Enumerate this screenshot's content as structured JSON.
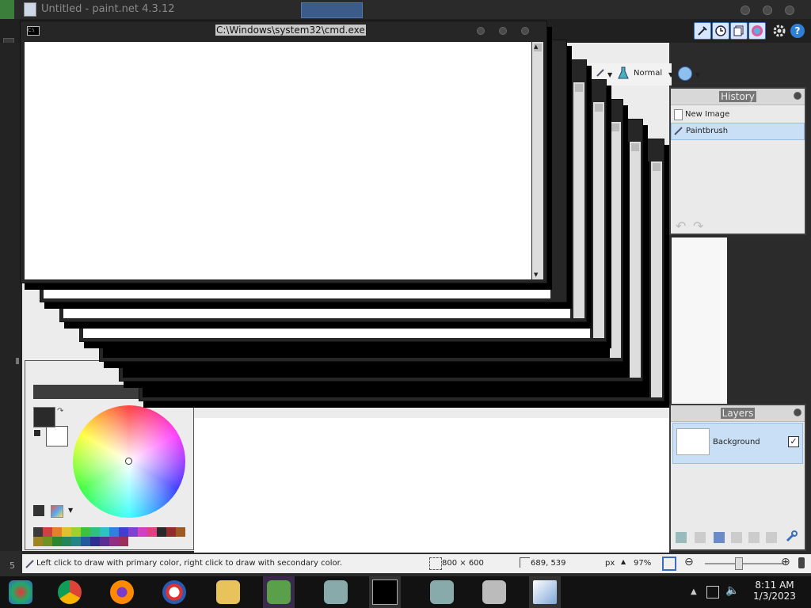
{
  "paintnet": {
    "title": "Untitled - paint.net 4.3.12",
    "blend_mode": "Normal",
    "history": {
      "title": "History",
      "items": [
        {
          "label": "New Image",
          "selected": false
        },
        {
          "label": "Paintbrush",
          "selected": true
        }
      ]
    },
    "layers": {
      "title": "Layers",
      "items": [
        {
          "label": "Background",
          "visible": true
        }
      ]
    },
    "status": {
      "hint": "Left click to draw with primary color, right click to draw with secondary color.",
      "image_size": "800 × 600",
      "cursor_pos": "689, 539",
      "units": "px",
      "zoom": "97%"
    },
    "primary_color": "#2a2a2a",
    "secondary_color": "#ffffff",
    "palette": [
      "#3a3a3a",
      "#d04040",
      "#e08030",
      "#e0c030",
      "#a0d030",
      "#40c040",
      "#30c080",
      "#30c0c0",
      "#3080e0",
      "#4040d0",
      "#8040d0",
      "#d040c0",
      "#e04080"
    ]
  },
  "cmd": {
    "title": "C:\\Windows\\system32\\cmd.exe"
  },
  "side_number": "5",
  "taskbar": {
    "time": "8:11 AM",
    "date": "1/3/2023"
  }
}
